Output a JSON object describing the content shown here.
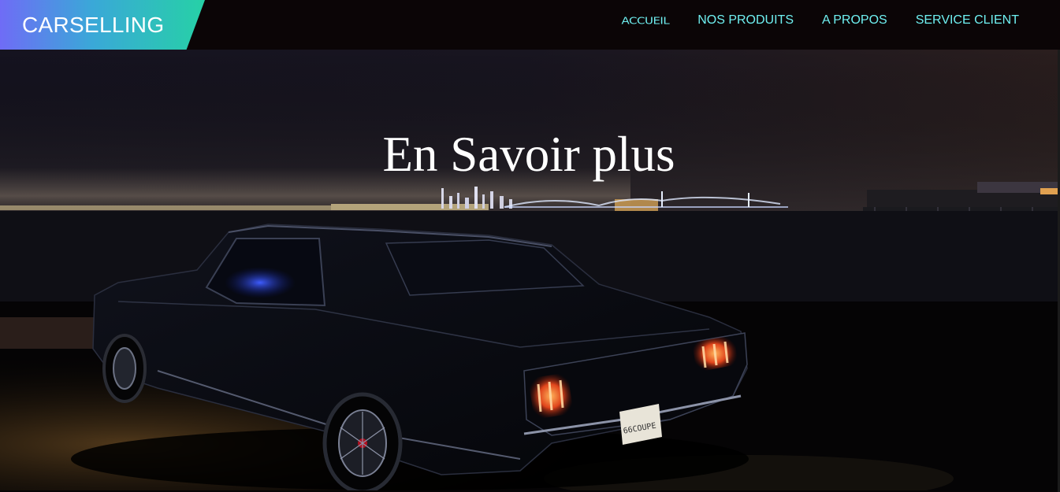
{
  "header": {
    "brand": "CARSELLING",
    "nav": [
      {
        "label": "ACCUEIL",
        "active": true
      },
      {
        "label": "NOS PRODUITS",
        "active": false
      },
      {
        "label": "A PROPOS",
        "active": false
      },
      {
        "label": "SERVICE CLIENT",
        "active": false
      }
    ]
  },
  "hero": {
    "title": "En Savoir plus",
    "plate_text": "66COUPE"
  },
  "colors": {
    "nav_text": "#6ff0f1",
    "brand_gradient_start": "#6f6cf6",
    "brand_gradient_end": "#26d1a6",
    "navbar_bg": "#0b0506"
  }
}
